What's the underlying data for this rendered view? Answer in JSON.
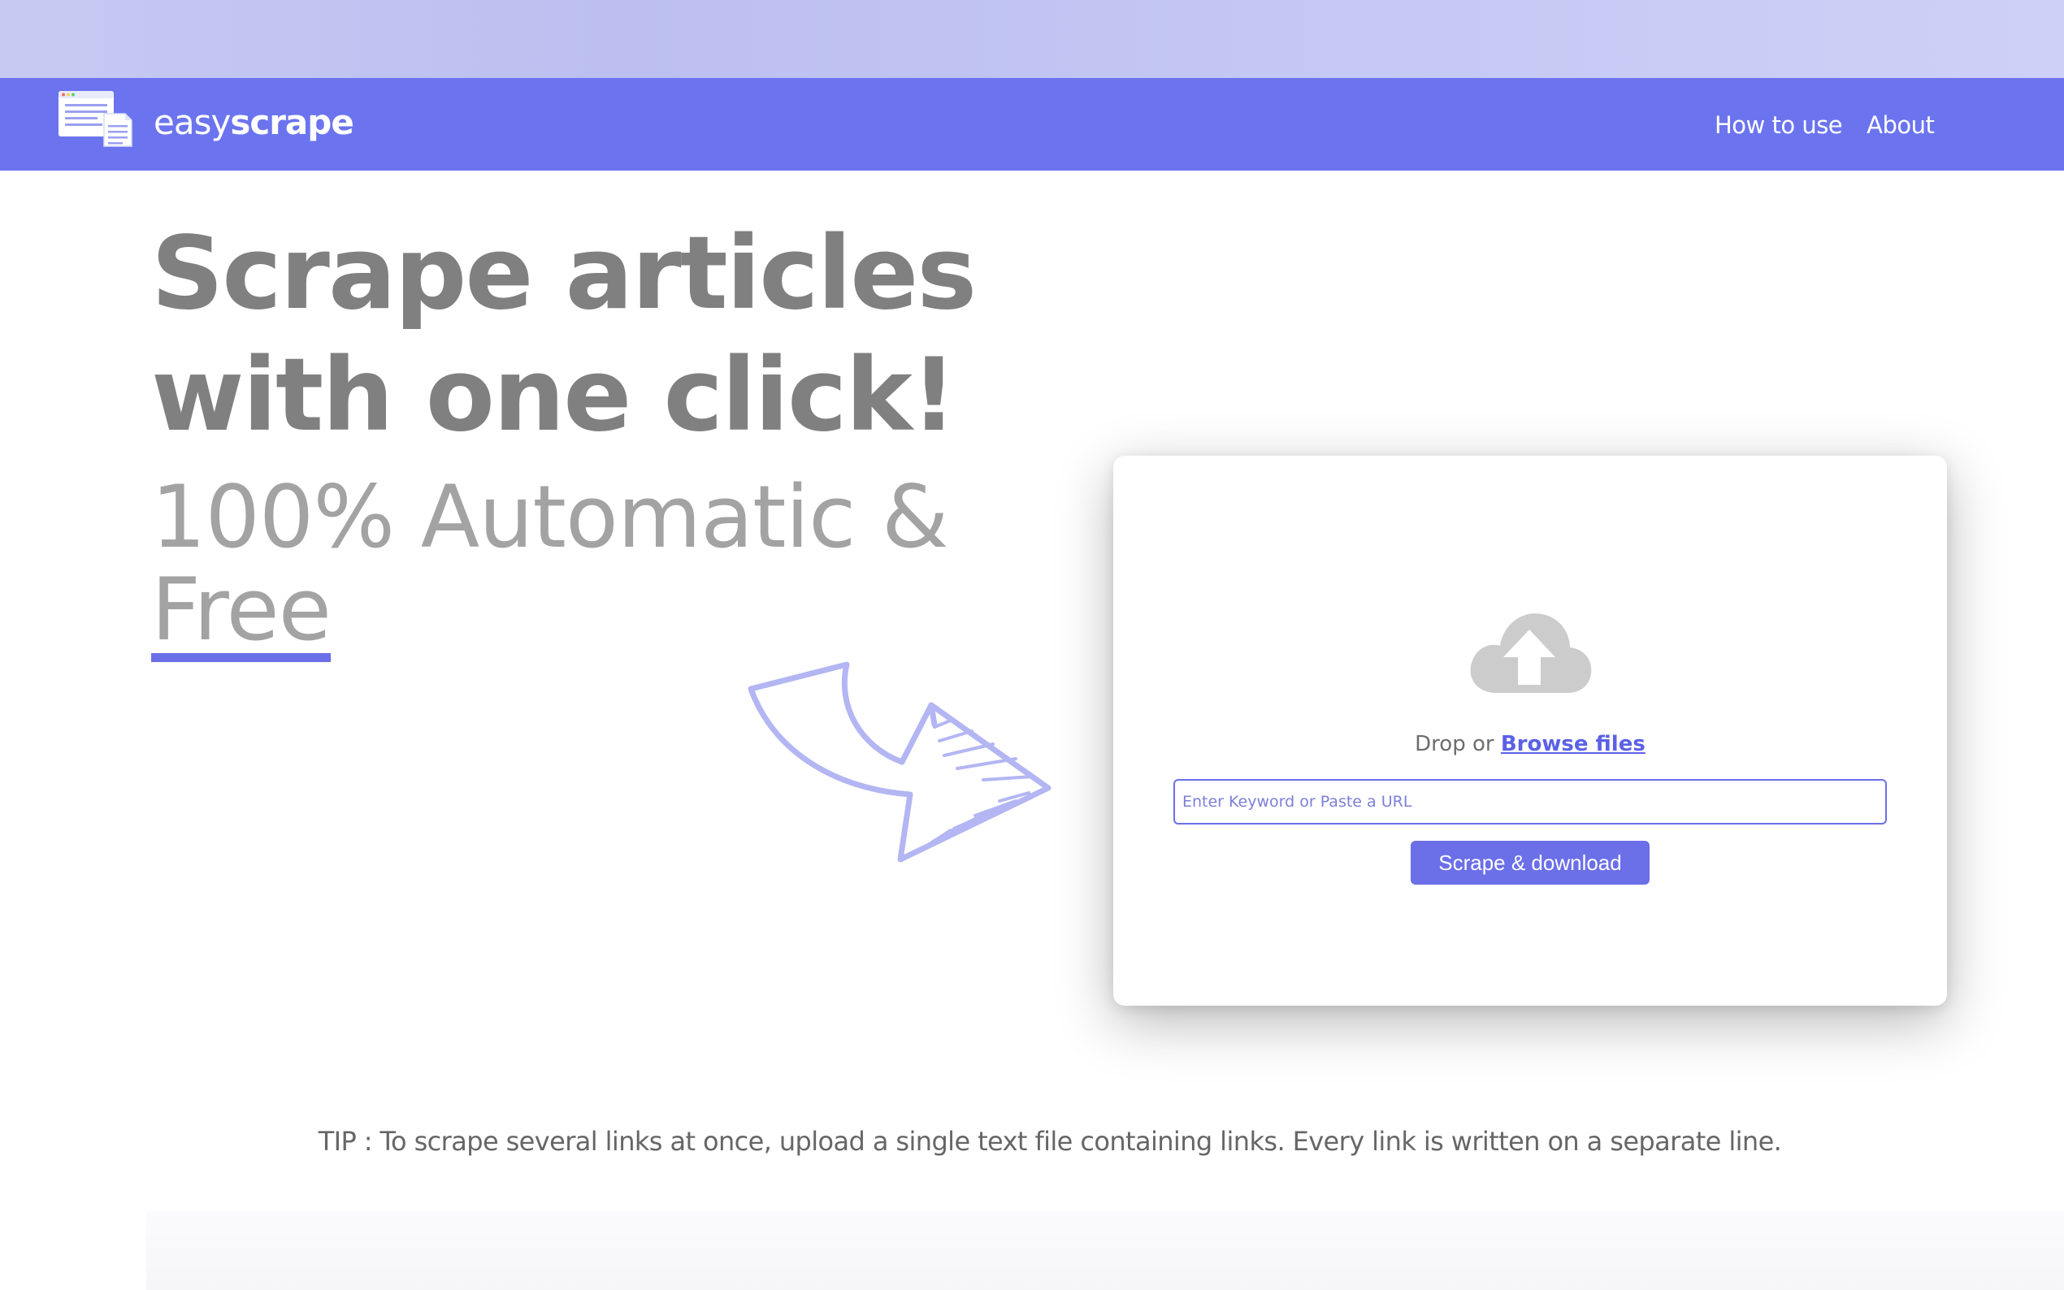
{
  "header": {
    "brand_light": "easy",
    "brand_bold": "scrape",
    "nav": [
      {
        "label": "How to use"
      },
      {
        "label": "About"
      }
    ]
  },
  "hero": {
    "title_line1": "Scrape articles",
    "title_line2": "with one click!",
    "subtitle_line1": "100% Automatic &",
    "subtitle_line2": "Free"
  },
  "upload": {
    "drop_text": "Drop or",
    "browse_label": "Browse files",
    "input_placeholder": "Enter Keyword or Paste a URL",
    "input_value": "",
    "button_label": "Scrape & download"
  },
  "tip": "TIP : To scrape several links at once, upload a single text file containing links. Every link is written on a separate line.",
  "icons": {
    "logo": "document-stack-icon",
    "upload": "cloud-upload-icon",
    "arrow": "hand-drawn-arrow-icon"
  },
  "colors": {
    "accent": "#6b74ee",
    "button": "#6b6fe8",
    "link": "#5b61e6",
    "heading": "#808080",
    "subheading": "#a3a3a3"
  }
}
